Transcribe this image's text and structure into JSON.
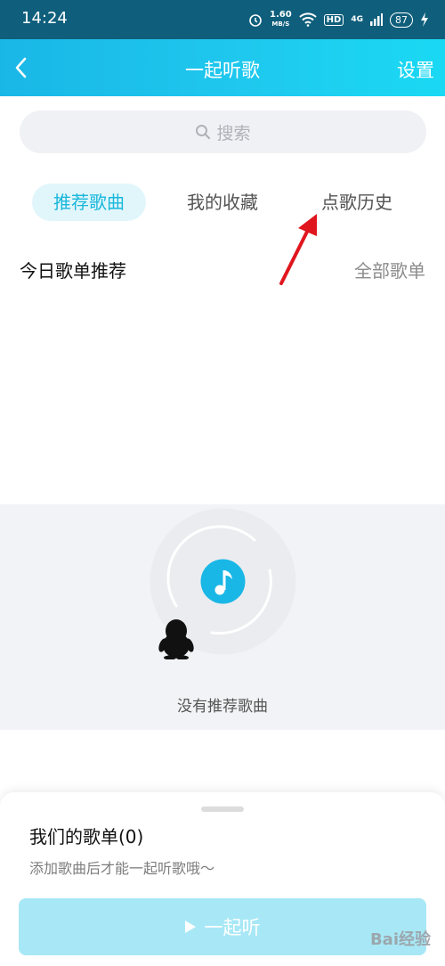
{
  "status": {
    "time": "14:24",
    "net_speed_top": "1.60",
    "net_speed_bottom": "MB/S",
    "hd": "HD",
    "signal": "4G",
    "battery": "87"
  },
  "header": {
    "title": "一起听歌",
    "settings": "设置",
    "back_icon": "chevron-left-icon"
  },
  "search": {
    "placeholder": "搜索",
    "icon": "search-icon"
  },
  "tabs": [
    {
      "label": "推荐歌曲",
      "active": true
    },
    {
      "label": "我的收藏",
      "active": false
    },
    {
      "label": "点歌历史",
      "active": false
    }
  ],
  "section": {
    "title": "今日歌单推荐",
    "link": "全部歌单"
  },
  "empty": {
    "text": "没有推荐歌曲",
    "icon": "music-note-icon"
  },
  "sheet": {
    "title": "我们的歌单(0)",
    "description": "添加歌曲后才能一起听歌哦～",
    "button_label": "一起听"
  },
  "watermark": "Bai经验",
  "colors": {
    "accent": "#19b7dc",
    "annotation_arrow": "#e0161e"
  }
}
